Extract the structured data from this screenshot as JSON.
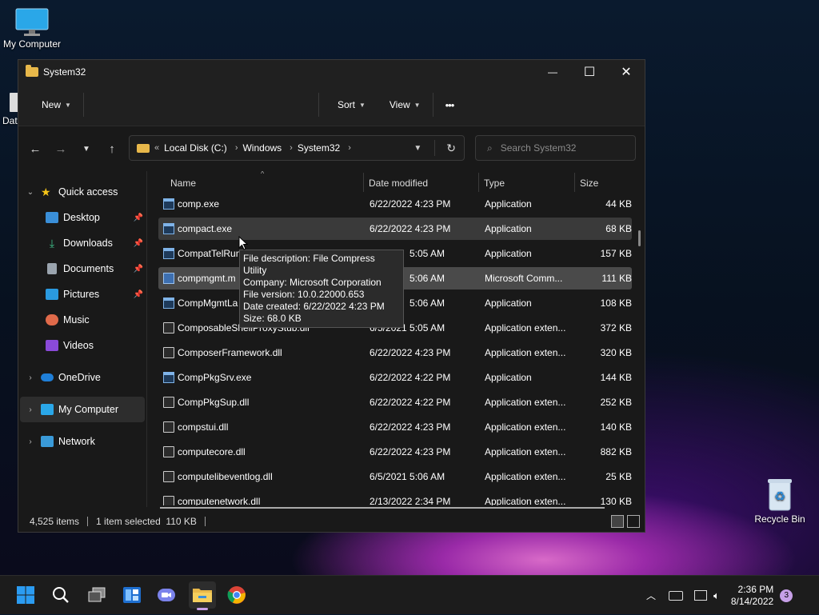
{
  "desktop": {
    "icons": [
      {
        "label": "My Computer"
      },
      {
        "label": "Recycle Bin"
      },
      {
        "label": "Data"
      }
    ]
  },
  "window": {
    "title": "System32",
    "controls": {
      "minimize": "—",
      "maximize": "☐",
      "close": "✕"
    }
  },
  "commandbar": {
    "new_label": "New",
    "sort_label": "Sort",
    "view_label": "View",
    "more_label": "•••"
  },
  "address": {
    "lead": "«",
    "crumbs": [
      "Local Disk (C:)",
      "Windows",
      "System32"
    ],
    "search_placeholder": "Search System32"
  },
  "sidebar": {
    "items": [
      {
        "label": "Quick access"
      },
      {
        "label": "Desktop"
      },
      {
        "label": "Downloads"
      },
      {
        "label": "Documents"
      },
      {
        "label": "Pictures"
      },
      {
        "label": "Music"
      },
      {
        "label": "Videos"
      },
      {
        "label": "OneDrive"
      },
      {
        "label": "My Computer"
      },
      {
        "label": "Network"
      }
    ]
  },
  "columns": {
    "name": "Name",
    "date": "Date modified",
    "type": "Type",
    "size": "Size"
  },
  "files": [
    {
      "name": "comp.exe",
      "date": "6/22/2022 4:23 PM",
      "type": "Application",
      "size": "44 KB"
    },
    {
      "name": "compact.exe",
      "date": "6/22/2022 4:23 PM",
      "type": "Application",
      "size": "68 KB"
    },
    {
      "name": "CompatTelRun",
      "date": "5:05 AM",
      "type": "Application",
      "size": "157 KB"
    },
    {
      "name": "compmgmt.m",
      "date": "5:06 AM",
      "type": "Microsoft Comm...",
      "size": "111 KB"
    },
    {
      "name": "CompMgmtLa",
      "date": "5:06 AM",
      "type": "Application",
      "size": "108 KB"
    },
    {
      "name": "ComposableShellProxyStub.dll",
      "date": "6/5/2021 5:05 AM",
      "type": "Application exten...",
      "size": "372 KB"
    },
    {
      "name": "ComposerFramework.dll",
      "date": "6/22/2022 4:23 PM",
      "type": "Application exten...",
      "size": "320 KB"
    },
    {
      "name": "CompPkgSrv.exe",
      "date": "6/22/2022 4:22 PM",
      "type": "Application",
      "size": "144 KB"
    },
    {
      "name": "CompPkgSup.dll",
      "date": "6/22/2022 4:22 PM",
      "type": "Application exten...",
      "size": "252 KB"
    },
    {
      "name": "compstui.dll",
      "date": "6/22/2022 4:23 PM",
      "type": "Application exten...",
      "size": "140 KB"
    },
    {
      "name": "computecore.dll",
      "date": "6/22/2022 4:23 PM",
      "type": "Application exten...",
      "size": "882 KB"
    },
    {
      "name": "computelibeventlog.dll",
      "date": "6/5/2021 5:06 AM",
      "type": "Application exten...",
      "size": "25 KB"
    },
    {
      "name": "computenetwork.dll",
      "date": "2/13/2022 2:34 PM",
      "type": "Application exten...",
      "size": "130 KB"
    }
  ],
  "tooltip": {
    "lines": [
      "File description: File Compress Utility",
      "Company: Microsoft Corporation",
      "File version: 10.0.22000.653",
      "Date created: 6/22/2022 4:23 PM",
      "Size: 68.0 KB"
    ]
  },
  "status": {
    "count": "4,525 items",
    "selected": "1 item selected  110 KB"
  },
  "taskbar": {
    "time": "2:36 PM",
    "date": "8/14/2022",
    "badge": "3"
  },
  "colors": {
    "accent": "#0067c0",
    "folder": "#e8b84a",
    "badge": "#c7a0e8"
  }
}
